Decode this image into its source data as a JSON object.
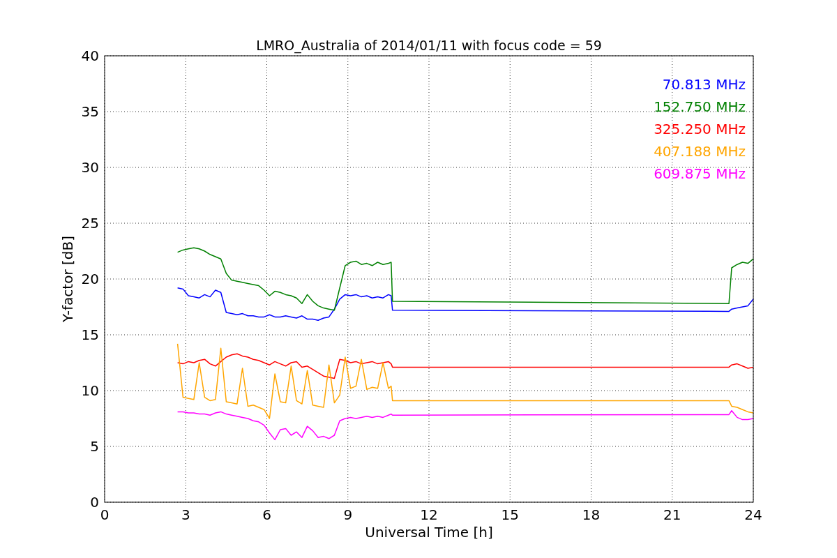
{
  "chart_data": {
    "type": "line",
    "title": "LMRO_Australia of 2014/01/11 with focus code = 59",
    "xlabel": "Universal Time [h]",
    "ylabel": "Y-factor [dB]",
    "xlim": [
      0,
      24
    ],
    "ylim": [
      0,
      40
    ],
    "xticks": [
      0,
      3,
      6,
      9,
      12,
      15,
      18,
      21,
      24
    ],
    "yticks": [
      0,
      5,
      10,
      15,
      20,
      25,
      30,
      35,
      40
    ],
    "grid": true,
    "x": [
      2.7,
      2.9,
      3.1,
      3.3,
      3.5,
      3.7,
      3.9,
      4.1,
      4.3,
      4.5,
      4.7,
      4.9,
      5.1,
      5.3,
      5.5,
      5.7,
      5.9,
      6.1,
      6.3,
      6.5,
      6.7,
      6.9,
      7.1,
      7.3,
      7.5,
      7.7,
      7.9,
      8.1,
      8.3,
      8.5,
      8.7,
      8.9,
      9.1,
      9.3,
      9.5,
      9.7,
      9.9,
      10.1,
      10.3,
      10.5,
      10.6,
      10.65,
      23.1,
      23.2,
      23.4,
      23.6,
      23.8,
      24.0
    ],
    "series": [
      {
        "name": "70.813 MHz",
        "color": "#0000ff",
        "values": [
          19.2,
          19.1,
          18.5,
          18.4,
          18.3,
          18.6,
          18.4,
          19.0,
          18.8,
          17.0,
          16.9,
          16.8,
          16.9,
          16.7,
          16.7,
          16.6,
          16.6,
          16.8,
          16.6,
          16.6,
          16.7,
          16.6,
          16.5,
          16.7,
          16.4,
          16.4,
          16.3,
          16.5,
          16.6,
          17.3,
          18.2,
          18.6,
          18.5,
          18.6,
          18.4,
          18.5,
          18.3,
          18.4,
          18.3,
          18.6,
          18.5,
          17.2,
          17.1,
          17.3,
          17.4,
          17.5,
          17.6,
          18.2
        ]
      },
      {
        "name": "152.750 MHz",
        "color": "#008000",
        "values": [
          22.4,
          22.6,
          22.7,
          22.8,
          22.7,
          22.5,
          22.2,
          22.0,
          21.8,
          20.5,
          19.9,
          19.8,
          19.7,
          19.6,
          19.5,
          19.4,
          19.0,
          18.5,
          18.9,
          18.8,
          18.6,
          18.5,
          18.3,
          17.8,
          18.6,
          18.0,
          17.6,
          17.4,
          17.3,
          17.2,
          19.2,
          21.2,
          21.5,
          21.6,
          21.3,
          21.4,
          21.2,
          21.5,
          21.3,
          21.4,
          21.5,
          18.0,
          17.8,
          21.0,
          21.3,
          21.5,
          21.4,
          21.8
        ]
      },
      {
        "name": "325.250 MHz",
        "color": "#ff0000",
        "values": [
          12.5,
          12.4,
          12.6,
          12.5,
          12.7,
          12.8,
          12.4,
          12.2,
          12.6,
          13.0,
          13.2,
          13.3,
          13.1,
          13.0,
          12.8,
          12.7,
          12.5,
          12.3,
          12.6,
          12.4,
          12.2,
          12.5,
          12.6,
          12.1,
          12.2,
          11.9,
          11.6,
          11.3,
          11.2,
          11.1,
          12.8,
          12.7,
          12.5,
          12.6,
          12.4,
          12.5,
          12.6,
          12.4,
          12.5,
          12.6,
          12.4,
          12.1,
          12.1,
          12.3,
          12.4,
          12.2,
          12.0,
          12.1
        ]
      },
      {
        "name": "407.188 MHz",
        "color": "#ffa500",
        "values": [
          14.2,
          9.4,
          9.3,
          9.2,
          12.5,
          9.4,
          9.1,
          9.2,
          13.8,
          9.0,
          8.9,
          8.8,
          12.0,
          8.6,
          8.7,
          8.5,
          8.3,
          7.5,
          11.5,
          9.0,
          8.9,
          12.2,
          9.1,
          8.8,
          11.8,
          8.7,
          8.6,
          8.5,
          12.3,
          8.9,
          9.6,
          13.0,
          10.2,
          10.4,
          12.8,
          10.1,
          10.3,
          10.2,
          12.5,
          10.2,
          10.4,
          9.1,
          9.1,
          8.6,
          8.5,
          8.3,
          8.1,
          8.0
        ]
      },
      {
        "name": "609.875 MHz",
        "color": "#ff00ff",
        "values": [
          8.1,
          8.1,
          8.0,
          8.0,
          7.9,
          7.9,
          7.8,
          8.0,
          8.1,
          7.9,
          7.8,
          7.7,
          7.6,
          7.5,
          7.3,
          7.2,
          6.9,
          6.2,
          5.6,
          6.5,
          6.6,
          6.0,
          6.3,
          5.8,
          6.8,
          6.4,
          5.8,
          5.9,
          5.7,
          6.0,
          7.3,
          7.5,
          7.6,
          7.5,
          7.6,
          7.7,
          7.6,
          7.7,
          7.6,
          7.8,
          7.9,
          7.8,
          7.85,
          8.2,
          7.6,
          7.4,
          7.4,
          7.5
        ]
      }
    ]
  }
}
